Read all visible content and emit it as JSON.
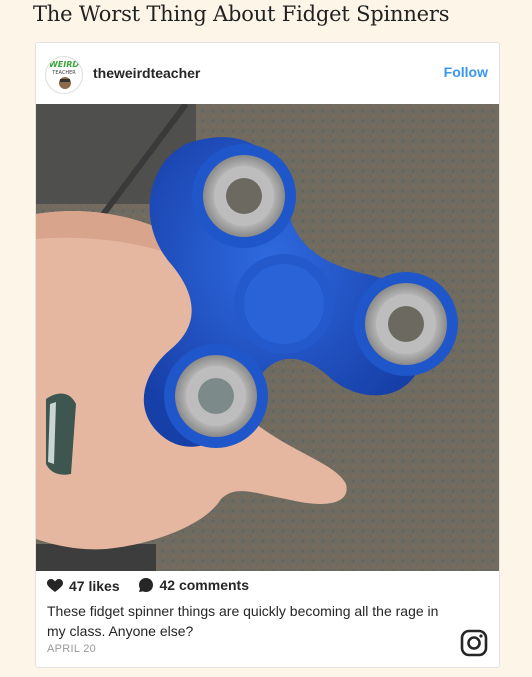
{
  "page": {
    "title": "The Worst Thing About Fidget Spinners"
  },
  "post": {
    "username": "theweirdteacher",
    "follow_label": "Follow",
    "avatar_text_top": "WEIRD",
    "avatar_text_mid": "TEACHER",
    "likes": "47 likes",
    "comments": "42 comments",
    "caption": "These fidget spinner things are quickly becoming all the rage in my class. Anyone else?",
    "date": "APRIL 20"
  },
  "colors": {
    "accent": "#3897f0",
    "background": "#fdf6e8",
    "spinner": "#1f56c9"
  },
  "icons": [
    "heart-icon",
    "comment-icon",
    "instagram-icon"
  ]
}
